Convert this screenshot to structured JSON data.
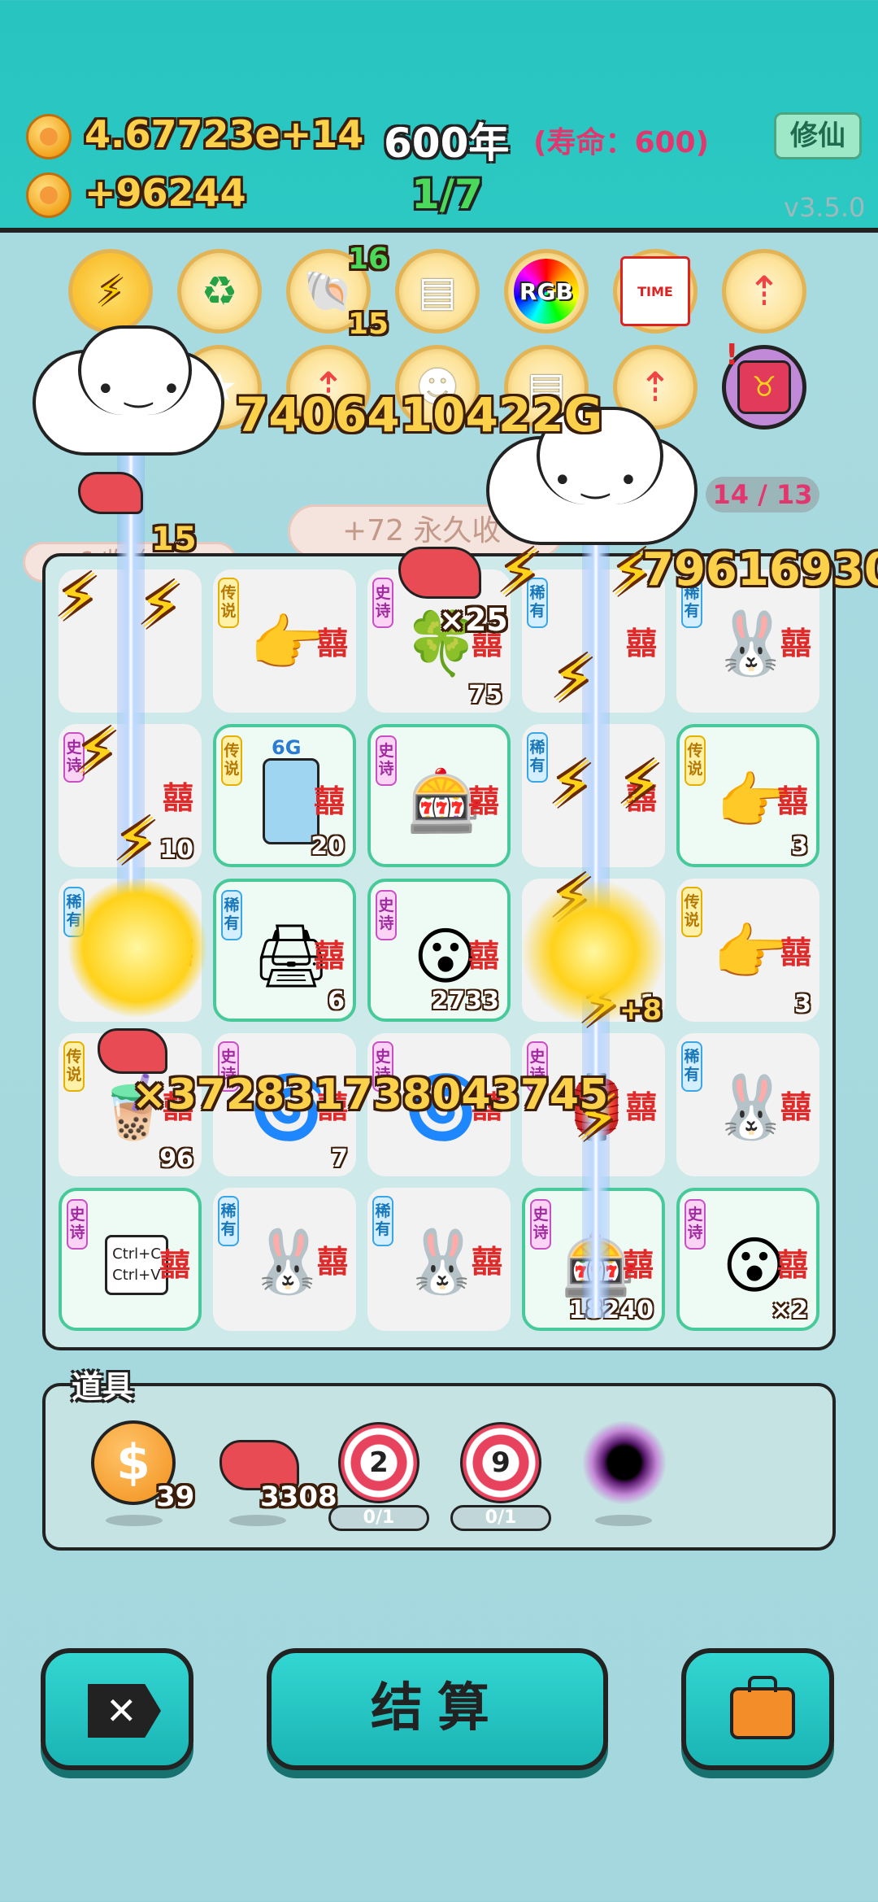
{
  "header": {
    "coins_total": "4.67723e+14",
    "coins_rate": "+96244",
    "year": "600年",
    "lifespan": "(寿命：600)",
    "stage": "1/7",
    "xian_button": "修仙",
    "version": "v3.5.0"
  },
  "boosts": {
    "shell_count_top": "16",
    "shell_count_bottom": "15",
    "rgb_label": "RGB",
    "time_label": "TIME",
    "progress": "14 / 13"
  },
  "floating": {
    "big_number_1": "7406410422G",
    "big_number_2": "79616930",
    "big_number_3": "×372831738043745",
    "permanent_bonus": "+72 永久收",
    "left_bonus": "+6 收益",
    "left_small": "15",
    "x25": "×25",
    "plus8": "+8"
  },
  "board": {
    "cells": [
      {
        "tag": "",
        "tag_color": "",
        "icon": "",
        "count": ""
      },
      {
        "tag": "传说",
        "tag_color": "y",
        "icon": "pointing-hand",
        "count": ""
      },
      {
        "tag": "史诗",
        "tag_color": "p",
        "icon": "clover",
        "count": "75"
      },
      {
        "tag": "稀有",
        "tag_color": "b",
        "icon": "",
        "count": ""
      },
      {
        "tag": "稀有",
        "tag_color": "b",
        "icon": "rabbit",
        "count": ""
      },
      {
        "tag": "史诗",
        "tag_color": "p",
        "icon": "",
        "count": "10"
      },
      {
        "tag": "传说",
        "tag_color": "y",
        "icon": "fridge",
        "count": "20"
      },
      {
        "tag": "史诗",
        "tag_color": "p",
        "icon": "claw-machine",
        "count": ""
      },
      {
        "tag": "稀有",
        "tag_color": "b",
        "icon": "",
        "count": ""
      },
      {
        "tag": "传说",
        "tag_color": "y",
        "icon": "pointing-hand",
        "count": "3"
      },
      {
        "tag": "稀有",
        "tag_color": "b",
        "icon": "",
        "count": ""
      },
      {
        "tag": "稀有",
        "tag_color": "b",
        "icon": "printer",
        "count": "6"
      },
      {
        "tag": "史诗",
        "tag_color": "p",
        "icon": "face",
        "count": "2733"
      },
      {
        "tag": "",
        "tag_color": "",
        "icon": "",
        "count": "1"
      },
      {
        "tag": "传说",
        "tag_color": "y",
        "icon": "pointing-hand",
        "count": "3"
      },
      {
        "tag": "传说",
        "tag_color": "y",
        "icon": "bubble-tea",
        "count": "96"
      },
      {
        "tag": "史诗",
        "tag_color": "p",
        "icon": "gpu",
        "count": "7"
      },
      {
        "tag": "史诗",
        "tag_color": "p",
        "icon": "gpu",
        "count": ""
      },
      {
        "tag": "史诗",
        "tag_color": "p",
        "icon": "lantern",
        "count": ""
      },
      {
        "tag": "稀有",
        "tag_color": "b",
        "icon": "rabbit",
        "count": ""
      },
      {
        "tag": "史诗",
        "tag_color": "p",
        "icon": "copy-paste",
        "count": ""
      },
      {
        "tag": "稀有",
        "tag_color": "b",
        "icon": "rabbit",
        "count": ""
      },
      {
        "tag": "稀有",
        "tag_color": "b",
        "icon": "rabbit",
        "count": ""
      },
      {
        "tag": "史诗",
        "tag_color": "p",
        "icon": "claw-machine",
        "count": "18240"
      },
      {
        "tag": "史诗",
        "tag_color": "p",
        "icon": "face",
        "count": "×2"
      }
    ],
    "xi_char": "囍",
    "copy_text": "Ctrl+C",
    "paste_text": "Ctrl+V",
    "gpu_badge": "6G"
  },
  "tools": {
    "title": "道具",
    "items": [
      {
        "icon": "dollar-coin-icon",
        "count": "39"
      },
      {
        "icon": "liver-icon",
        "count": "3308"
      },
      {
        "icon": "target-icon",
        "number": "2",
        "progress": "0/1"
      },
      {
        "icon": "target-icon",
        "number": "9",
        "progress": "0/1"
      },
      {
        "icon": "black-hole-icon"
      }
    ]
  },
  "bottom": {
    "settle_label": "结算"
  },
  "colors": {
    "teal_header": "#2cc9c3",
    "background": "#a4d8de",
    "rare_blue": "#3aa6e6",
    "epic_purple": "#c94fc5",
    "legend_yellow": "#e6b000"
  }
}
